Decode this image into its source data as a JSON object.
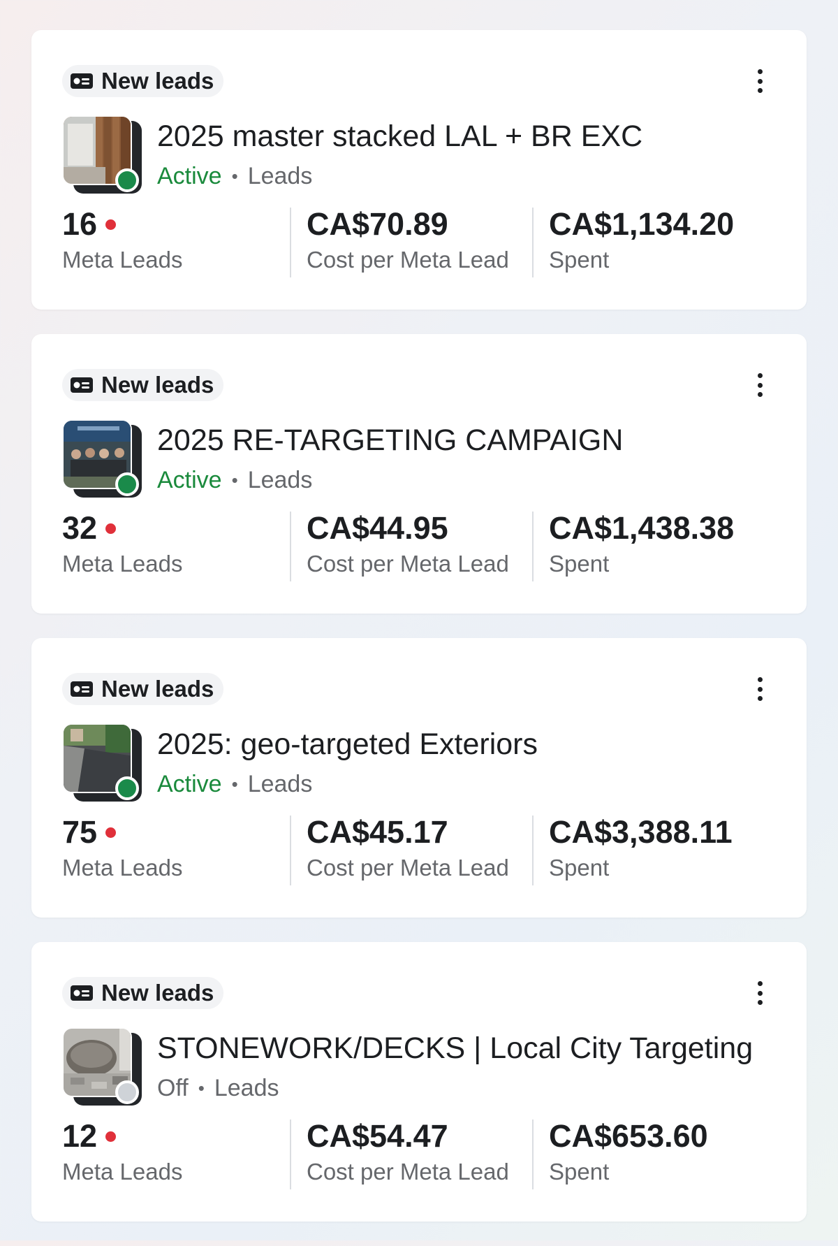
{
  "campaigns": [
    {
      "badge": "New leads",
      "badge_icon": "lead-card-icon",
      "title": "2025 master stacked LAL + BR EXC",
      "status": "Active",
      "status_color": "#1a8a3c",
      "status_dot_color": "#1a8a4a",
      "objective": "Leads",
      "thumbnail": "fence-patio-thumbnail",
      "metrics": {
        "leads_value": "16",
        "leads_label": "Meta Leads",
        "cost_value": "CA$70.89",
        "cost_label": "Cost per Meta Lead",
        "spent_value": "CA$1,134.20",
        "spent_label": "Spent"
      }
    },
    {
      "badge": "New leads",
      "badge_icon": "lead-card-icon",
      "title": "2025 RE-TARGETING CAMPAIGN",
      "status": "Active",
      "status_color": "#1a8a3c",
      "status_dot_color": "#1a8a4a",
      "objective": "Leads",
      "thumbnail": "team-photo-thumbnail",
      "metrics": {
        "leads_value": "32",
        "leads_label": "Meta Leads",
        "cost_value": "CA$44.95",
        "cost_label": "Cost per Meta Lead",
        "spent_value": "CA$1,438.38",
        "spent_label": "Spent"
      }
    },
    {
      "badge": "New leads",
      "badge_icon": "lead-card-icon",
      "title": "2025: geo-targeted Exteriors",
      "status": "Active",
      "status_color": "#1a8a3c",
      "status_dot_color": "#1a8a4a",
      "objective": "Leads",
      "thumbnail": "paver-walkway-thumbnail",
      "metrics": {
        "leads_value": "75",
        "leads_label": "Meta Leads",
        "cost_value": "CA$45.17",
        "cost_label": "Cost per Meta Lead",
        "spent_value": "CA$3,388.11",
        "spent_label": "Spent"
      }
    },
    {
      "badge": "New leads",
      "badge_icon": "lead-card-icon",
      "title": "STONEWORK/DECKS | Local City Targeting",
      "status": "Off",
      "status_color": "#65676b",
      "status_dot_color": "#cfd3d8",
      "objective": "Leads",
      "thumbnail": "stone-patio-thumbnail",
      "metrics": {
        "leads_value": "12",
        "leads_label": "Meta Leads",
        "cost_value": "CA$54.47",
        "cost_label": "Cost per Meta Lead",
        "spent_value": "CA$653.60",
        "spent_label": "Spent"
      }
    }
  ],
  "separator": "•",
  "menu_icon": "more-vertical-icon",
  "alert_dot_color": "#e0303a"
}
